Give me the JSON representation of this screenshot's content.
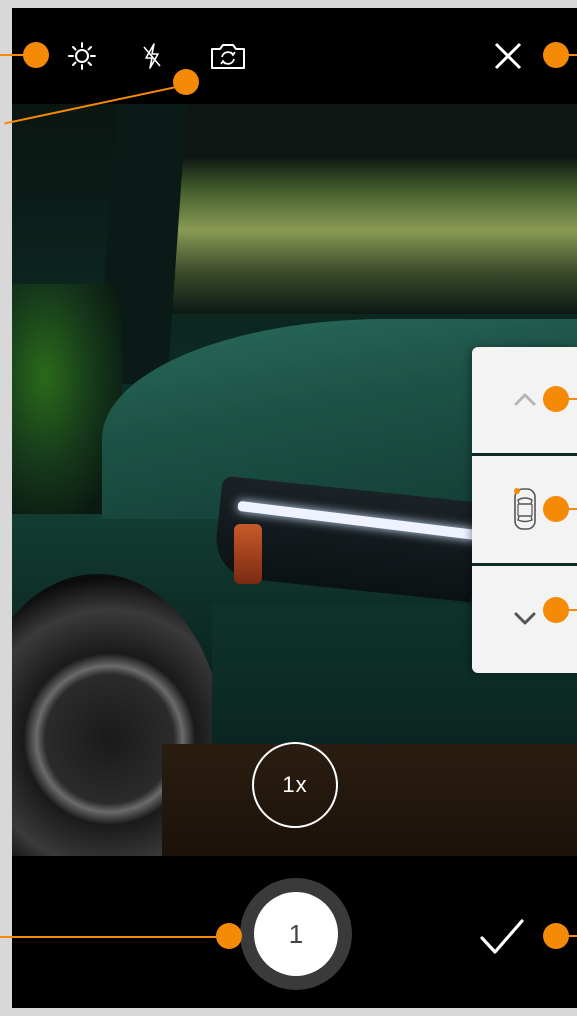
{
  "topbar": {
    "icons": [
      "brightness-icon",
      "flash-off-icon",
      "switch-camera-icon",
      "close-icon"
    ]
  },
  "panel": {
    "icons": [
      "chevron-up-icon",
      "car-top-view-icon",
      "chevron-down-icon"
    ]
  },
  "camera": {
    "zoom_label": "1x",
    "shot_count": "1"
  },
  "colors": {
    "accent": "#f58a07",
    "bar": "#000000",
    "panel": "#f3f3f3",
    "text_on_dark": "#ffffff"
  }
}
